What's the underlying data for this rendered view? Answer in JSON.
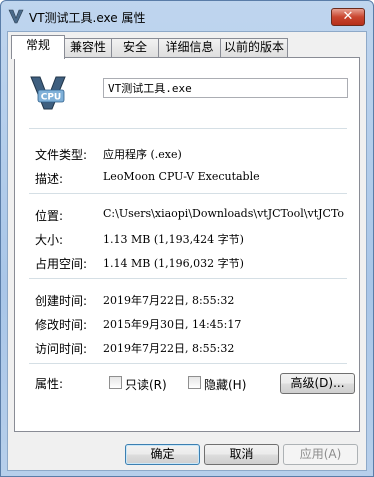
{
  "window": {
    "title": "VT测试工具.exe 属性",
    "close_label": "✕"
  },
  "tabs": [
    {
      "label": "常规",
      "active": true
    },
    {
      "label": "兼容性",
      "active": false
    },
    {
      "label": "安全",
      "active": false
    },
    {
      "label": "详细信息",
      "active": false
    },
    {
      "label": "以前的版本",
      "active": false
    }
  ],
  "general": {
    "icon_text": "CPU",
    "file_name": "VT测试工具.exe",
    "rows": [
      {
        "label": "文件类型:",
        "value": "应用程序 (.exe)"
      },
      {
        "label": "描述:",
        "value": "LeoMoon CPU-V Executable"
      },
      {
        "label": "位置:",
        "value": "C:\\Users\\xiaopi\\Downloads\\vtJCTool\\vtJCTo"
      },
      {
        "label": "大小:",
        "value": "1.13 MB (1,193,424 字节)"
      },
      {
        "label": "占用空间:",
        "value": "1.14 MB (1,196,032 字节)"
      },
      {
        "label": "创建时间:",
        "value": "2019年7月22日, 8:55:32"
      },
      {
        "label": "修改时间:",
        "value": "2015年9月30日, 14:45:17"
      },
      {
        "label": "访问时间:",
        "value": "2019年7月22日, 8:55:32"
      }
    ],
    "attributes_label": "属性:",
    "readonly_label": "只读(R)",
    "hidden_label": "隐藏(H)",
    "advanced_label": "高级(D)..."
  },
  "buttons": {
    "ok": "确定",
    "cancel": "取消",
    "apply": "应用(A)"
  }
}
